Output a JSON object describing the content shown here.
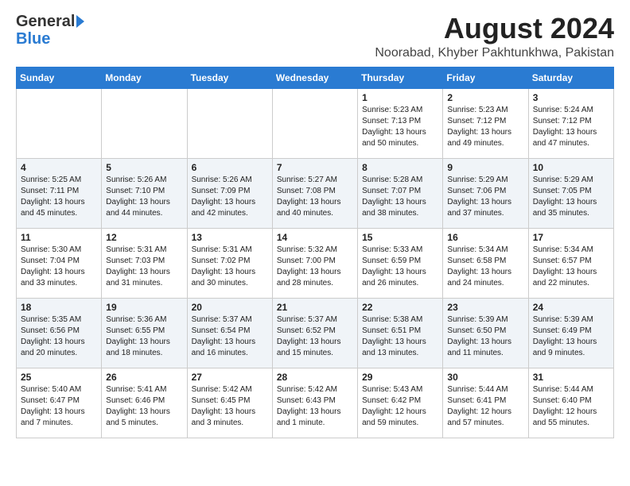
{
  "logo": {
    "part1": "General",
    "part2": "Blue"
  },
  "title": "August 2024",
  "subtitle": "Noorabad, Khyber Pakhtunkhwa, Pakistan",
  "columns": [
    "Sunday",
    "Monday",
    "Tuesday",
    "Wednesday",
    "Thursday",
    "Friday",
    "Saturday"
  ],
  "weeks": [
    [
      {
        "day": "",
        "info": ""
      },
      {
        "day": "",
        "info": ""
      },
      {
        "day": "",
        "info": ""
      },
      {
        "day": "",
        "info": ""
      },
      {
        "day": "1",
        "info": "Sunrise: 5:23 AM\nSunset: 7:13 PM\nDaylight: 13 hours\nand 50 minutes."
      },
      {
        "day": "2",
        "info": "Sunrise: 5:23 AM\nSunset: 7:12 PM\nDaylight: 13 hours\nand 49 minutes."
      },
      {
        "day": "3",
        "info": "Sunrise: 5:24 AM\nSunset: 7:12 PM\nDaylight: 13 hours\nand 47 minutes."
      }
    ],
    [
      {
        "day": "4",
        "info": "Sunrise: 5:25 AM\nSunset: 7:11 PM\nDaylight: 13 hours\nand 45 minutes."
      },
      {
        "day": "5",
        "info": "Sunrise: 5:26 AM\nSunset: 7:10 PM\nDaylight: 13 hours\nand 44 minutes."
      },
      {
        "day": "6",
        "info": "Sunrise: 5:26 AM\nSunset: 7:09 PM\nDaylight: 13 hours\nand 42 minutes."
      },
      {
        "day": "7",
        "info": "Sunrise: 5:27 AM\nSunset: 7:08 PM\nDaylight: 13 hours\nand 40 minutes."
      },
      {
        "day": "8",
        "info": "Sunrise: 5:28 AM\nSunset: 7:07 PM\nDaylight: 13 hours\nand 38 minutes."
      },
      {
        "day": "9",
        "info": "Sunrise: 5:29 AM\nSunset: 7:06 PM\nDaylight: 13 hours\nand 37 minutes."
      },
      {
        "day": "10",
        "info": "Sunrise: 5:29 AM\nSunset: 7:05 PM\nDaylight: 13 hours\nand 35 minutes."
      }
    ],
    [
      {
        "day": "11",
        "info": "Sunrise: 5:30 AM\nSunset: 7:04 PM\nDaylight: 13 hours\nand 33 minutes."
      },
      {
        "day": "12",
        "info": "Sunrise: 5:31 AM\nSunset: 7:03 PM\nDaylight: 13 hours\nand 31 minutes."
      },
      {
        "day": "13",
        "info": "Sunrise: 5:31 AM\nSunset: 7:02 PM\nDaylight: 13 hours\nand 30 minutes."
      },
      {
        "day": "14",
        "info": "Sunrise: 5:32 AM\nSunset: 7:00 PM\nDaylight: 13 hours\nand 28 minutes."
      },
      {
        "day": "15",
        "info": "Sunrise: 5:33 AM\nSunset: 6:59 PM\nDaylight: 13 hours\nand 26 minutes."
      },
      {
        "day": "16",
        "info": "Sunrise: 5:34 AM\nSunset: 6:58 PM\nDaylight: 13 hours\nand 24 minutes."
      },
      {
        "day": "17",
        "info": "Sunrise: 5:34 AM\nSunset: 6:57 PM\nDaylight: 13 hours\nand 22 minutes."
      }
    ],
    [
      {
        "day": "18",
        "info": "Sunrise: 5:35 AM\nSunset: 6:56 PM\nDaylight: 13 hours\nand 20 minutes."
      },
      {
        "day": "19",
        "info": "Sunrise: 5:36 AM\nSunset: 6:55 PM\nDaylight: 13 hours\nand 18 minutes."
      },
      {
        "day": "20",
        "info": "Sunrise: 5:37 AM\nSunset: 6:54 PM\nDaylight: 13 hours\nand 16 minutes."
      },
      {
        "day": "21",
        "info": "Sunrise: 5:37 AM\nSunset: 6:52 PM\nDaylight: 13 hours\nand 15 minutes."
      },
      {
        "day": "22",
        "info": "Sunrise: 5:38 AM\nSunset: 6:51 PM\nDaylight: 13 hours\nand 13 minutes."
      },
      {
        "day": "23",
        "info": "Sunrise: 5:39 AM\nSunset: 6:50 PM\nDaylight: 13 hours\nand 11 minutes."
      },
      {
        "day": "24",
        "info": "Sunrise: 5:39 AM\nSunset: 6:49 PM\nDaylight: 13 hours\nand 9 minutes."
      }
    ],
    [
      {
        "day": "25",
        "info": "Sunrise: 5:40 AM\nSunset: 6:47 PM\nDaylight: 13 hours\nand 7 minutes."
      },
      {
        "day": "26",
        "info": "Sunrise: 5:41 AM\nSunset: 6:46 PM\nDaylight: 13 hours\nand 5 minutes."
      },
      {
        "day": "27",
        "info": "Sunrise: 5:42 AM\nSunset: 6:45 PM\nDaylight: 13 hours\nand 3 minutes."
      },
      {
        "day": "28",
        "info": "Sunrise: 5:42 AM\nSunset: 6:43 PM\nDaylight: 13 hours\nand 1 minute."
      },
      {
        "day": "29",
        "info": "Sunrise: 5:43 AM\nSunset: 6:42 PM\nDaylight: 12 hours\nand 59 minutes."
      },
      {
        "day": "30",
        "info": "Sunrise: 5:44 AM\nSunset: 6:41 PM\nDaylight: 12 hours\nand 57 minutes."
      },
      {
        "day": "31",
        "info": "Sunrise: 5:44 AM\nSunset: 6:40 PM\nDaylight: 12 hours\nand 55 minutes."
      }
    ]
  ]
}
